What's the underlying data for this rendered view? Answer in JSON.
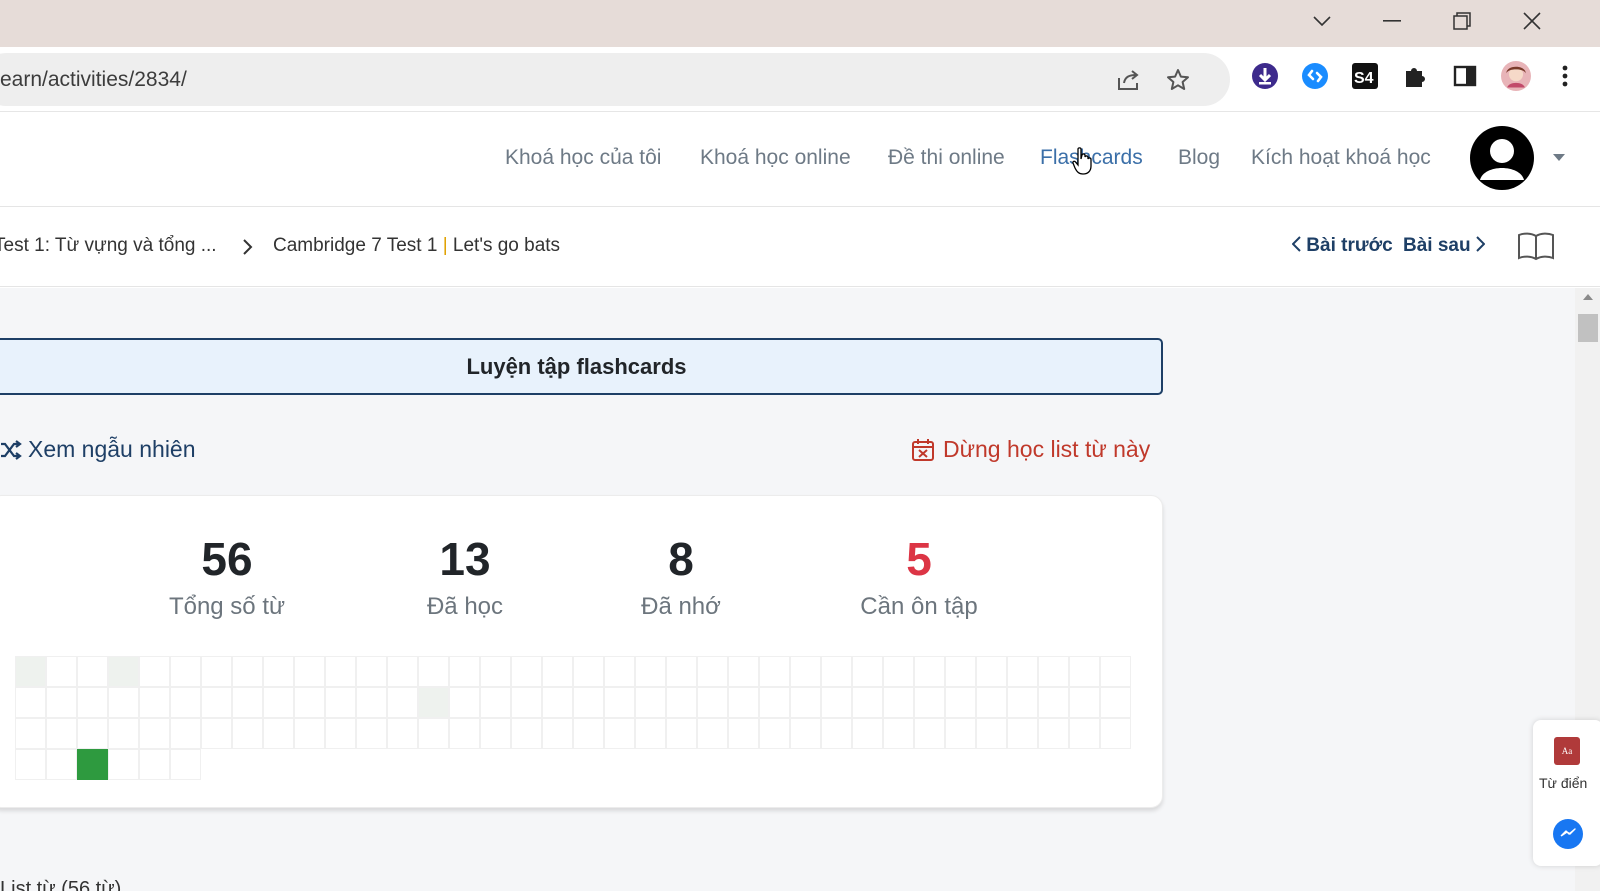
{
  "browser": {
    "url": "earn/activities/2834/"
  },
  "nav": {
    "items": [
      {
        "label": "Khoá học của tôi"
      },
      {
        "label": "Khoá học online"
      },
      {
        "label": "Đề thi online"
      },
      {
        "label": "Flashcards"
      },
      {
        "label": "Blog"
      },
      {
        "label": "Kích hoạt khoá học"
      }
    ],
    "active": "Flashcards"
  },
  "breadcrumb": {
    "parent": "Test 1: Từ vựng và tổng ...",
    "current_prefix": "Cambridge 7 Test 1",
    "current_separator": "|",
    "current_suffix": "Let's go bats",
    "prev": "Bài trước",
    "next": "Bài sau"
  },
  "practice": {
    "button_label": "Luyện tập flashcards",
    "shuffle_label": "Xem ngẫu nhiên",
    "stop_label": "Dừng học list từ này"
  },
  "stats": {
    "total": {
      "value": "56",
      "label": "Tổng số từ"
    },
    "learned": {
      "value": "13",
      "label": "Đã học"
    },
    "remembered": {
      "value": "8",
      "label": "Đã nhớ"
    },
    "review": {
      "value": "5",
      "label": "Cần ôn tập",
      "color": "#dc3545"
    }
  },
  "grid": {
    "total_cells": 56,
    "highlight_cell": 100,
    "learned_color": "#2e9a3f"
  },
  "widget": {
    "dictionary_label": "Từ điển",
    "dictionary_icon_text": "Aa"
  },
  "bottom": {
    "text": "List từ (56 từ)"
  },
  "icons": {
    "share": "share-icon",
    "star": "star-icon",
    "puzzle": "puzzle-icon",
    "sidepanel": "sidepanel-icon",
    "menu": "more-vert-icon"
  }
}
